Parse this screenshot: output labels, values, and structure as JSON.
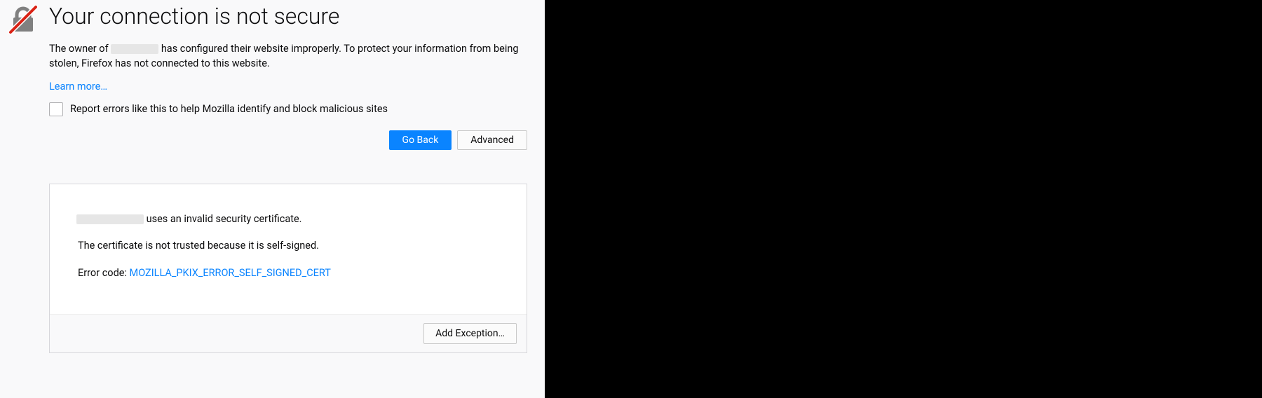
{
  "header": {
    "title": "Your connection is not secure"
  },
  "body": {
    "desc_prefix": "The owner of ",
    "desc_suffix": " has configured their website improperly. To protect your information from being stolen, Firefox has not connected to this website.",
    "learn_more": "Learn more…",
    "report_label": "Report errors like this to help Mozilla identify and block malicious sites"
  },
  "buttons": {
    "go_back": "Go Back",
    "advanced": "Advanced",
    "add_exception": "Add Exception…"
  },
  "details": {
    "line1_suffix": " uses an invalid security certificate.",
    "line2": "The certificate is not trusted because it is self-signed.",
    "error_label": "Error code: ",
    "error_code": "MOZILLA_PKIX_ERROR_SELF_SIGNED_CERT"
  },
  "colors": {
    "link": "#0a84ff",
    "primary": "#0a84ff",
    "page_bg": "#f9f9fa"
  }
}
